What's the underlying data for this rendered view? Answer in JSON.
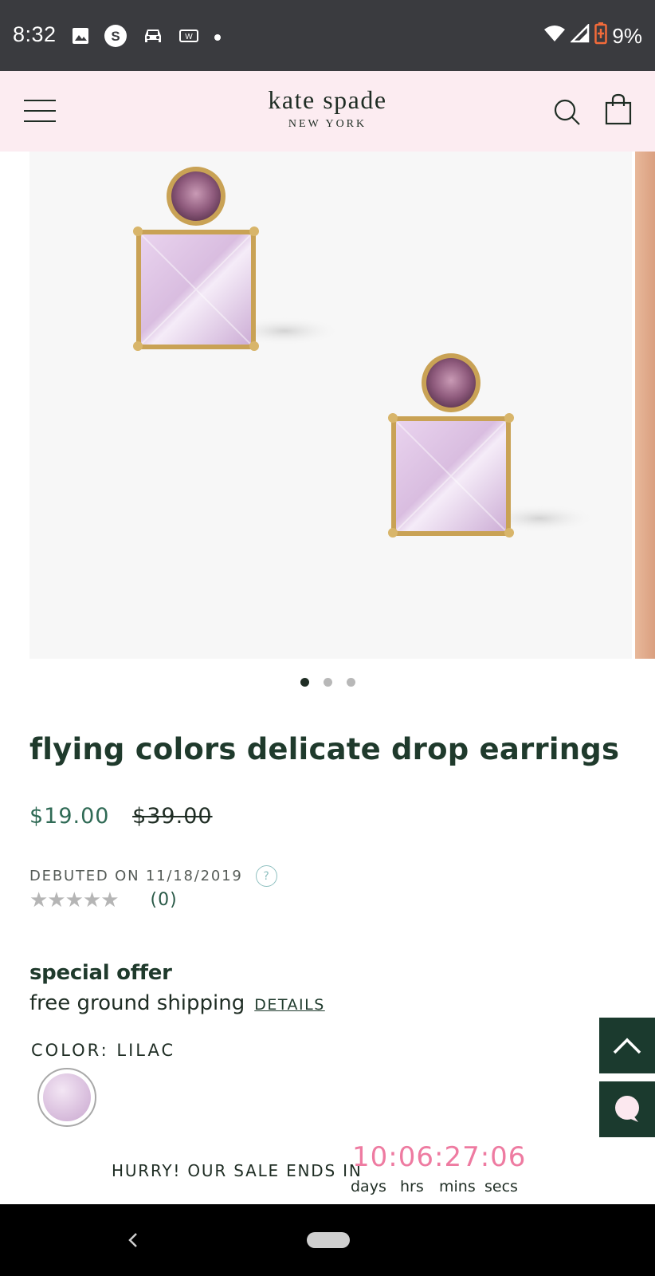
{
  "status_bar": {
    "time": "8:32",
    "battery": "9%",
    "left_icons": [
      "image-icon",
      "s-badge-icon",
      "car-icon",
      "w-icon",
      "dot-icon"
    ],
    "right_icons": [
      "wifi-icon",
      "signal-icon",
      "battery-low-icon"
    ],
    "battery_color": "#f26b3a"
  },
  "header": {
    "brand_name": "kate spade",
    "brand_sub": "NEW YORK",
    "background": "#fcecf1"
  },
  "carousel": {
    "total_slides": 3,
    "active_slide": 1
  },
  "product": {
    "title": "flying colors delicate drop earrings",
    "sale_price": "$19.00",
    "original_price": "$39.00",
    "debuted_label": "DEBUTED ON 11/18/2019",
    "help_icon": "?",
    "stars": "★★★★★",
    "rating_value": 0,
    "review_count": "(0)"
  },
  "offer": {
    "title": "special offer",
    "text": "free ground shipping",
    "details_link": "DETAILS"
  },
  "color": {
    "label": "COLOR: LILAC",
    "swatch_name": "lilac"
  },
  "sale": {
    "text": "HURRY! OUR SALE ENDS IN",
    "timer": "10:06:27:06",
    "units": {
      "days": "days",
      "hrs": "hrs",
      "mins": "mins",
      "secs": "secs"
    }
  },
  "colors": {
    "brand_green": "#1b3a2e",
    "sale_price_green": "#2f6a55",
    "timer_pink": "#ee7ba1"
  }
}
